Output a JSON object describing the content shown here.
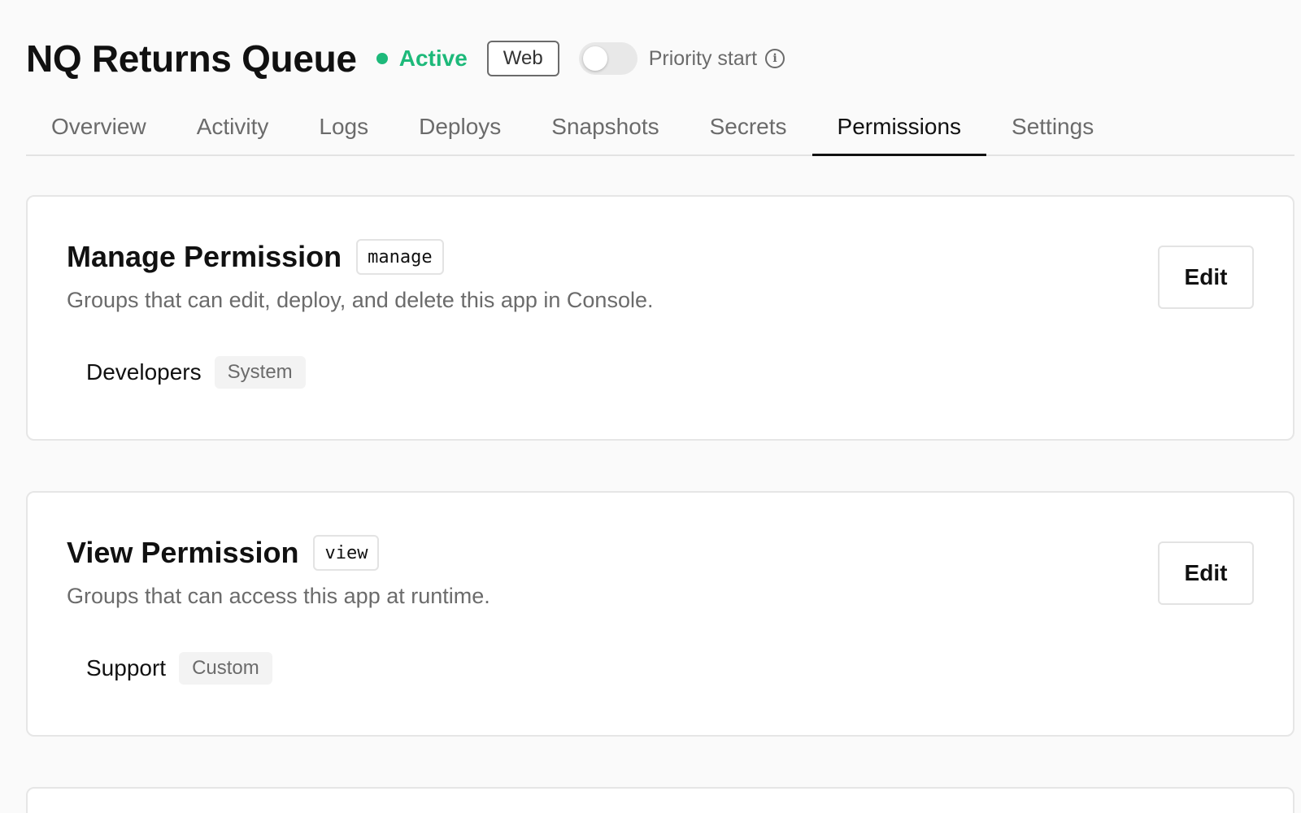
{
  "header": {
    "title": "NQ Returns Queue",
    "status": {
      "label": "Active",
      "color": "#1db97a"
    },
    "platform_badge": "Web",
    "priority_toggle": {
      "label": "Priority start",
      "enabled": false,
      "info_icon": "info-icon"
    }
  },
  "tabs": [
    {
      "label": "Overview",
      "active": false
    },
    {
      "label": "Activity",
      "active": false
    },
    {
      "label": "Logs",
      "active": false
    },
    {
      "label": "Deploys",
      "active": false
    },
    {
      "label": "Snapshots",
      "active": false
    },
    {
      "label": "Secrets",
      "active": false
    },
    {
      "label": "Permissions",
      "active": true
    },
    {
      "label": "Settings",
      "active": false
    }
  ],
  "permissions": [
    {
      "title": "Manage Permission",
      "code": "manage",
      "description": "Groups that can edit, deploy, and delete this app in Console.",
      "group": {
        "name": "Developers",
        "tag": "System"
      },
      "edit_label": "Edit"
    },
    {
      "title": "View Permission",
      "code": "view",
      "description": "Groups that can access this app at runtime.",
      "group": {
        "name": "Support",
        "tag": "Custom"
      },
      "edit_label": "Edit"
    }
  ]
}
